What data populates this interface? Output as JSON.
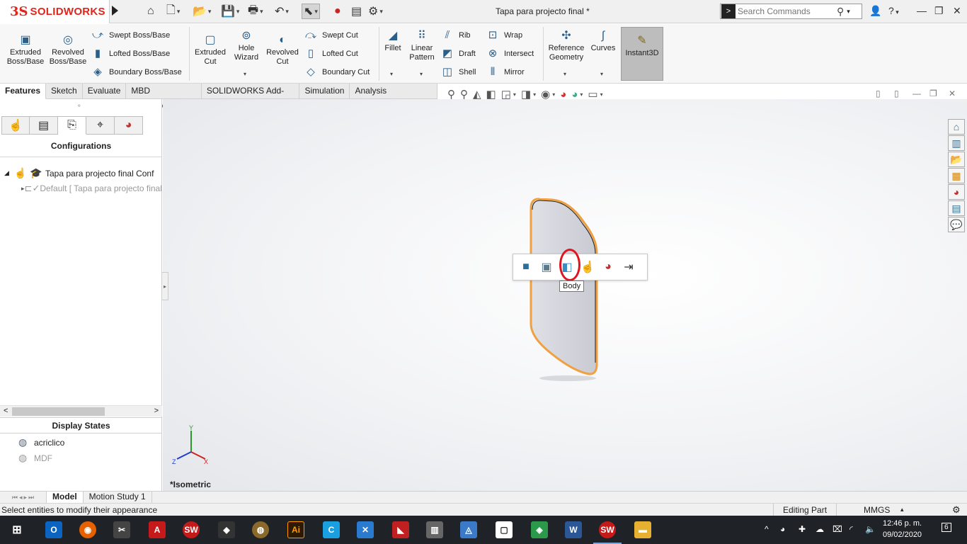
{
  "app": {
    "brand_prefix": "3S",
    "brand": "SOLIDWORKS",
    "document_title": "Tapa para projecto final *"
  },
  "search": {
    "placeholder": "Search Commands"
  },
  "ribbon": {
    "extruded_boss": "Extruded Boss/Base",
    "revolved_boss": "Revolved Boss/Base",
    "swept_boss": "Swept Boss/Base",
    "lofted_boss": "Lofted Boss/Base",
    "boundary_boss": "Boundary Boss/Base",
    "extruded_cut": "Extruded Cut",
    "hole_wizard": "Hole Wizard",
    "revolved_cut": "Revolved Cut",
    "swept_cut": "Swept Cut",
    "lofted_cut": "Lofted Cut",
    "boundary_cut": "Boundary Cut",
    "fillet": "Fillet",
    "linear_pattern": "Linear Pattern",
    "rib": "Rib",
    "draft": "Draft",
    "shell": "Shell",
    "wrap": "Wrap",
    "intersect": "Intersect",
    "mirror": "Mirror",
    "reference_geometry": "Reference Geometry",
    "curves": "Curves",
    "instant3d": "Instant3D"
  },
  "tabs": [
    "Features",
    "Sketch",
    "Evaluate",
    "MBD Dimensions",
    "SOLIDWORKS Add-Ins",
    "Simulation",
    "Analysis Preparation"
  ],
  "left_panel": {
    "header": "Configurations",
    "tree": {
      "root": "Tapa para projecto final Conf",
      "child": "Default [ Tapa para projecto final ]"
    },
    "display_states_header": "Display States",
    "display_states": [
      "acriclico",
      "MDF"
    ]
  },
  "viewport": {
    "tooltip": "Body",
    "view_label": "*Isometric",
    "triad": {
      "x": "X",
      "y": "Y",
      "z": "Z"
    }
  },
  "bottom_tabs": [
    "Model",
    "Motion Study 1"
  ],
  "status": {
    "message": "Select entities to modify their appearance",
    "mode": "Editing Part",
    "units": "MMGS"
  },
  "taskbar": {
    "time": "12:46 p. m.",
    "date": "09/02/2020",
    "notifications": "6"
  },
  "colors": {
    "brand_red": "#e1251b",
    "part_outline": "#f0a040",
    "highlight_circle": "#e0141e",
    "instant3d_active": "#bdbdbd"
  }
}
